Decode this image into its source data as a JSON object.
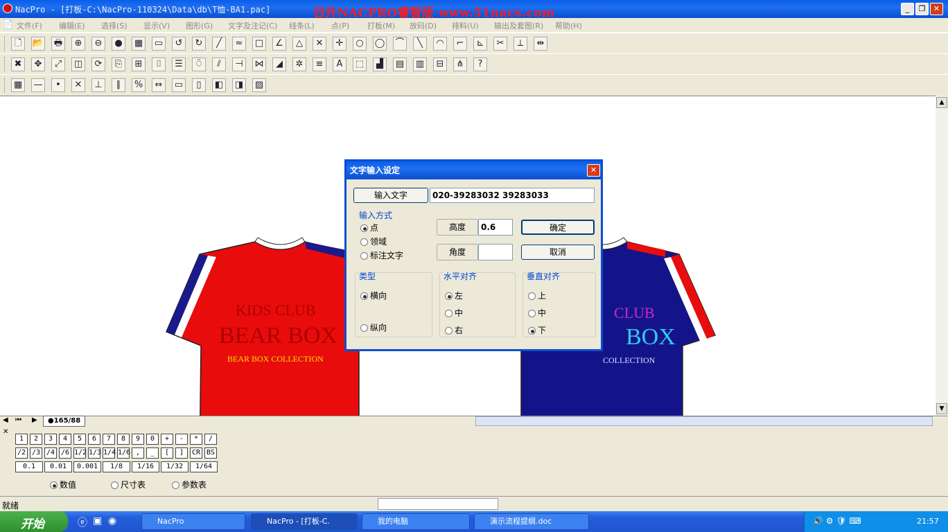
{
  "window": {
    "title": "NacPro - [打板-C:\\NacPro-110324\\Data\\db\\T恤-BA1.pac]",
    "watermark": "日升NACPRO睿智版 www.51nacs.com"
  },
  "menu": [
    "文件(F)",
    "编辑(E)",
    "选择(S)",
    "显示(V)",
    "图形(G)",
    "文字及注记(C)",
    "线条(L)",
    "点(P)",
    "打板(M)",
    "放码(D)",
    "排料(U)",
    "输出及套图(R)",
    "帮助(H)"
  ],
  "toolbar_icons": {
    "row1": [
      "new-icon",
      "open-icon",
      "print-icon",
      "zoom-in-icon",
      "zoom-out-icon",
      "refresh-icon",
      "fit-icon",
      "monitor-icon",
      "undo-icon",
      "redo-icon",
      "line-icon",
      "curve-icon",
      "rect-icon",
      "angle-icon",
      "triangle-icon",
      "cross-icon",
      "point-icon",
      "circle-icon",
      "ellipse-icon",
      "bezier-icon",
      "diagonal-icon",
      "arc-icon",
      "corner-icon",
      "measure-icon",
      "cut-icon",
      "dart-icon",
      "pleat-icon"
    ],
    "row2": [
      "delete-icon",
      "move-icon",
      "scale-icon",
      "mirror-icon",
      "rotate-icon",
      "copy-icon",
      "align-icon",
      "fold-icon",
      "stack-icon",
      "spiral-icon",
      "split-icon",
      "trim-icon",
      "join-icon",
      "grade-icon",
      "grid-icon",
      "notch-icon",
      "text-icon",
      "label-icon",
      "bar-icon",
      "window-icon",
      "table-icon",
      "layout-icon",
      "size-icon",
      "help-icon"
    ],
    "row3": [
      "grid-select-icon",
      "seg-line-icon",
      "seg-point-icon",
      "intersect-icon",
      "perp-icon",
      "parallel-icon",
      "percent-icon",
      "width-icon",
      "piece1-icon",
      "piece2-icon",
      "piece3-icon",
      "piece4-icon",
      "hatch-icon"
    ]
  },
  "shirt_red": {
    "line1": "KIDS  CLUB",
    "line2": "BEAR   BOX",
    "line3": "BEAR BOX COLLECTION",
    "body_color": "#e80c0c",
    "text_color": "#b00000",
    "line3_color": "#ffe000"
  },
  "shirt_blue": {
    "line1": "CLUB",
    "line2": "BOX",
    "line3": "COLLECTION",
    "body_color": "#14148a",
    "line1_color": "#c828c8",
    "line2_color": "#38c8f0"
  },
  "dialog": {
    "title": "文字输入设定",
    "input_button": "输入文字",
    "input_value": "020-39283032 39283033",
    "method_label": "输入方式",
    "method_options": [
      "点",
      "领域",
      "标注文字"
    ],
    "height_label": "高度",
    "height_value": "0.6",
    "angle_label": "角度",
    "angle_value": "",
    "ok": "确定",
    "cancel": "取消",
    "type_label": "类型",
    "type_options": [
      "横向",
      "纵向"
    ],
    "h_align_label": "水平对齐",
    "h_align_options": [
      "左",
      "中",
      "右"
    ],
    "v_align_label": "垂直对齐",
    "v_align_options": [
      "上",
      "中",
      "下"
    ]
  },
  "sheet_tab": "●165/88",
  "keypad": {
    "row1": [
      "1",
      "2",
      "3",
      "4",
      "5",
      "6",
      "7",
      "8",
      "9",
      "0",
      "+",
      "-",
      "*",
      "/"
    ],
    "row2": [
      "/2",
      "/3",
      "/4",
      "/6",
      "1/2",
      "1/3",
      "1/4",
      "1/6",
      ",",
      "_",
      "[",
      "]",
      "CR",
      "BS"
    ],
    "row3": [
      "0.1",
      "0.01",
      "0.001",
      "1/8",
      "1/16",
      "1/32",
      "1/64"
    ],
    "modes": [
      "数值",
      "尺寸表",
      "参数表"
    ]
  },
  "status": "就绪",
  "taskbar": {
    "start": "开始",
    "tasks": [
      "NacPro",
      "NacPro - [打板-C.",
      "我的电脑",
      "演示流程提纲.doc"
    ],
    "time": "21:57"
  }
}
